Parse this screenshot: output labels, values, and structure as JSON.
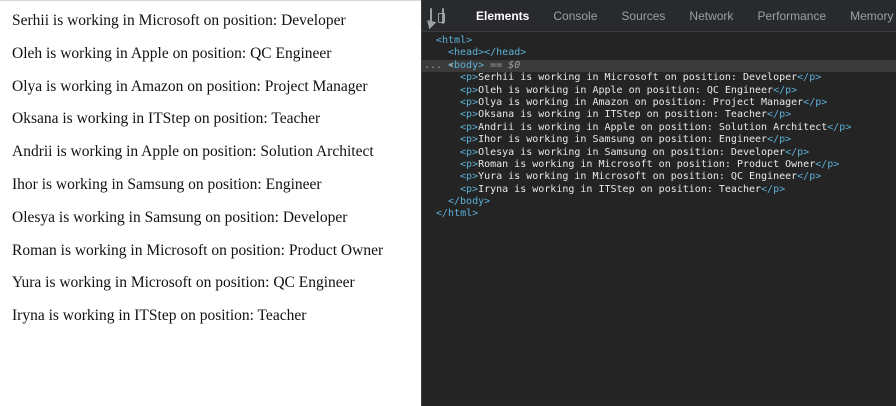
{
  "page": {
    "paragraphs": [
      "Serhii is working in Microsoft on position: Developer",
      "Oleh is working in Apple on position: QC Engineer",
      "Olya is working in Amazon on position: Project Manager",
      "Oksana is working in ITStep on position: Teacher",
      "Andrii is working in Apple on position: Solution Architect",
      "Ihor is working in Samsung on position: Engineer",
      "Olesya is working in Samsung on position: Developer",
      "Roman is working in Microsoft on position: Product Owner",
      "Yura is working in Microsoft on position: QC Engineer",
      "Iryna is working in ITStep on position: Teacher"
    ]
  },
  "devtools": {
    "icons": [
      "inspect-element-icon",
      "device-toolbar-icon"
    ],
    "tabs": [
      "Elements",
      "Console",
      "Sources",
      "Network",
      "Performance",
      "Memory"
    ],
    "active_tab": "Elements",
    "tree": {
      "html_open": "<html>",
      "head": "<head></head>",
      "body_gutter": "... ▾",
      "body_open": "<body>",
      "body_eq": " == $0",
      "p_open": "<p>",
      "p_close": "</p>",
      "body_close": "</body>",
      "html_close": "</html>"
    },
    "colors": {
      "tag": "#5db0d7",
      "text": "#e8e8e8",
      "background": "#242424"
    }
  }
}
